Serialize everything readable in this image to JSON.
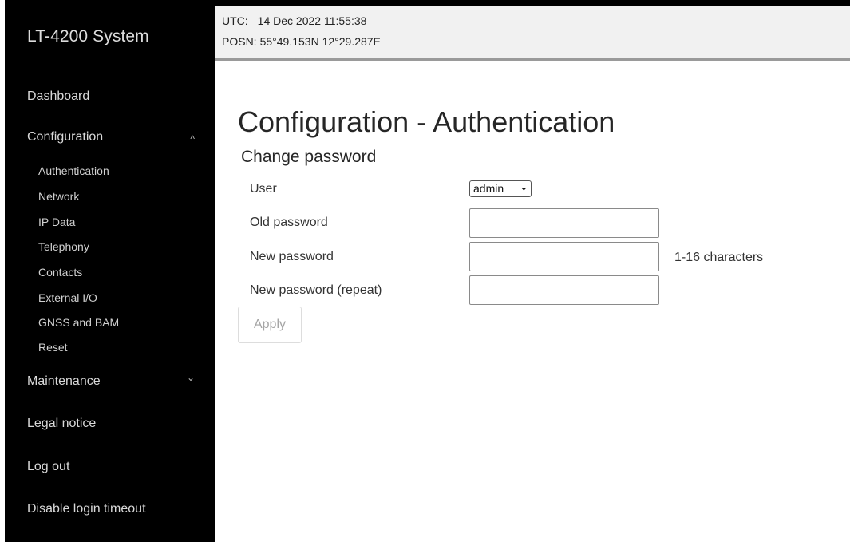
{
  "app": {
    "title": "LT-4200 System"
  },
  "status": {
    "utc_label": "UTC:",
    "utc_value": "14 Dec 2022 11:55:38",
    "posn_label": "POSN:",
    "posn_value": "55°49.153N 12°29.287E"
  },
  "sidebar": {
    "dashboard": "Dashboard",
    "configuration": "Configuration",
    "configuration_chevron": "^",
    "config_items": [
      {
        "label": "Authentication"
      },
      {
        "label": "Network"
      },
      {
        "label": "IP Data"
      },
      {
        "label": "Telephony"
      },
      {
        "label": "Contacts"
      },
      {
        "label": "External I/O"
      },
      {
        "label": "GNSS and BAM"
      },
      {
        "label": "Reset"
      }
    ],
    "maintenance": "Maintenance",
    "maintenance_chevron": "⌄",
    "legal_notice": "Legal notice",
    "log_out": "Log out",
    "disable_login_timeout": "Disable login timeout"
  },
  "main": {
    "title": "Configuration - Authentication",
    "section": "Change password",
    "form": {
      "user_label": "User",
      "user_value": "admin",
      "old_password_label": "Old password",
      "old_password_value": "",
      "new_password_label": "New password",
      "new_password_value": "",
      "new_password_hint": "1-16 characters",
      "repeat_password_label": "New password (repeat)",
      "repeat_password_value": "",
      "apply_label": "Apply"
    }
  },
  "colors": {
    "sidebar_bg": "#000000",
    "topbar_bg": "#f1f1f1",
    "disabled_text": "#a5a5a5"
  }
}
